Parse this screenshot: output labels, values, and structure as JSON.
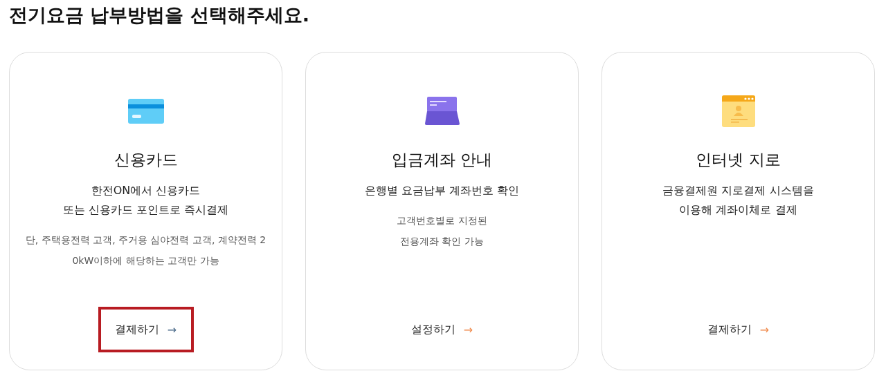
{
  "heading": "전기요금 납부방법을 선택해주세요.",
  "cards": [
    {
      "title": "신용카드",
      "description": [
        "한전ON에서 신용카드",
        "또는 신용카드 포인트로 즉시결제"
      ],
      "note": [
        "단, 주택용전력 고객, 주거용 심야전력 고객, 계약전력 2",
        "0kW이하에 해당하는 고객만 가능"
      ],
      "button": "결제하기",
      "arrow": "→",
      "highlighted": true
    },
    {
      "title": "입금계좌 안내",
      "description": [
        "은행별 요금납부 계좌번호 확인"
      ],
      "note": [
        "고객번호별로 지정된",
        "전용계좌 확인 가능"
      ],
      "button": "설정하기",
      "arrow": "→",
      "highlighted": false
    },
    {
      "title": "인터넷 지로",
      "description": [
        "금융결제원 지로결제 시스템을",
        "이용해 계좌이체로 결제"
      ],
      "button": "결제하기",
      "arrow": "→",
      "highlighted": false
    }
  ]
}
